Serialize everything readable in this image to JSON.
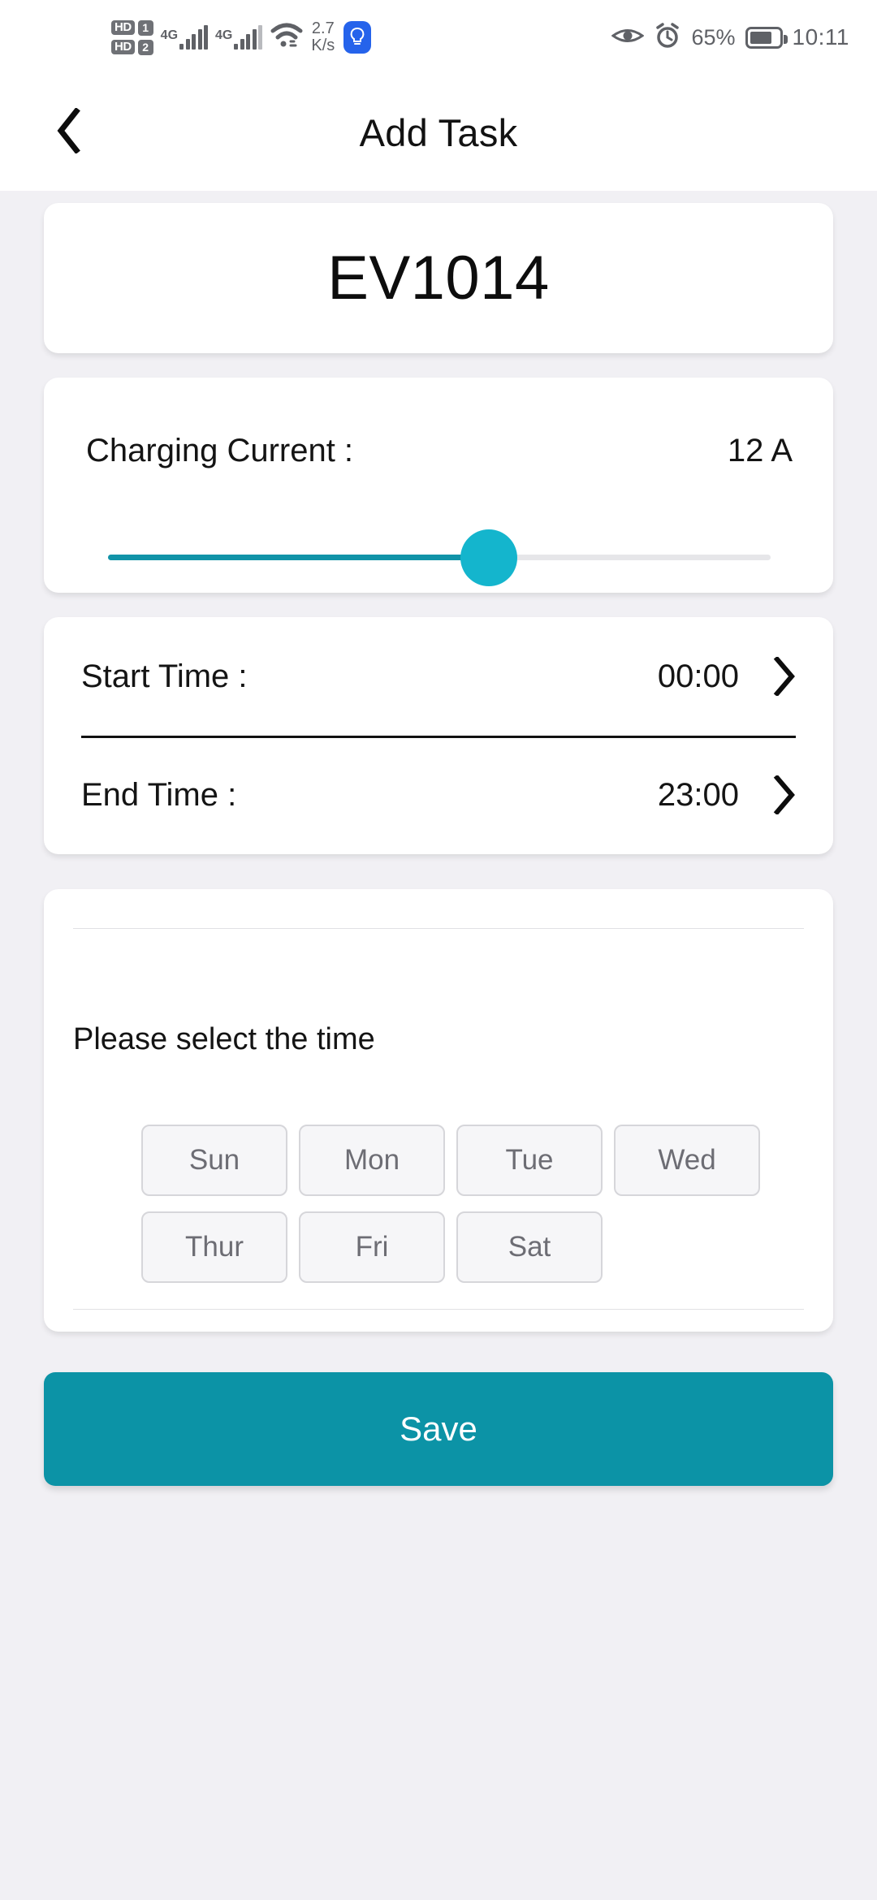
{
  "statusbar": {
    "sim1_hd": "HD",
    "sim1_num": "1",
    "sim2_hd": "HD",
    "sim2_num": "2",
    "net1": "4G",
    "net2": "4G",
    "data_speed_value": "2.7",
    "data_speed_unit": "K/s",
    "bulb_icon": "lightbulb-icon",
    "eye_icon": "eye-comfort-icon",
    "alarm_icon": "alarm-clock-icon",
    "battery_percent": "65%",
    "clock": "10:11",
    "wifi_icon": "wifi-icon",
    "battery_icon": "battery-icon"
  },
  "appbar": {
    "back_icon": "chevron-left-icon",
    "title": "Add Task"
  },
  "device": {
    "name": "EV1014"
  },
  "charging_current": {
    "label": "Charging Current :",
    "value": "12 A",
    "slider_percent": 57.5,
    "track_color": "#1193a8",
    "thumb_color": "#14b5cd"
  },
  "times": {
    "start": {
      "label": "Start Time :",
      "value": "00:00",
      "chevron": "chevron-right-icon"
    },
    "end": {
      "label": "End Time :",
      "value": "23:00",
      "chevron": "chevron-right-icon"
    }
  },
  "days": {
    "title": "Please select the time",
    "items": [
      {
        "label": "Sun"
      },
      {
        "label": "Mon"
      },
      {
        "label": "Tue"
      },
      {
        "label": "Wed"
      },
      {
        "label": "Thur"
      },
      {
        "label": "Fri"
      },
      {
        "label": "Sat"
      }
    ]
  },
  "save": {
    "label": "Save",
    "color": "#0c93a6"
  }
}
